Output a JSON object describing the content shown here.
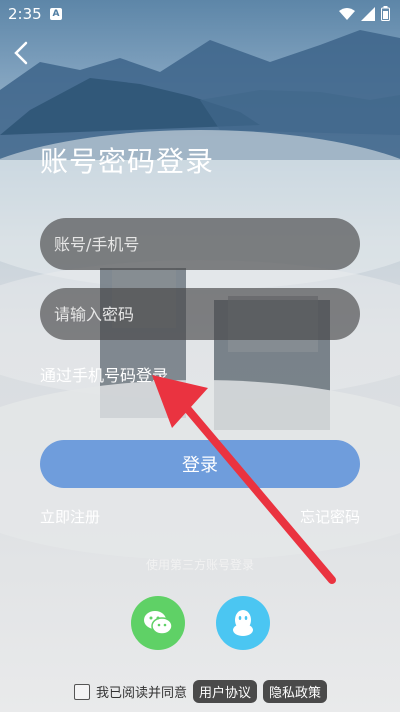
{
  "status": {
    "time": "2:35",
    "app_icon": "A"
  },
  "page": {
    "title": "账号密码登录"
  },
  "form": {
    "account_placeholder": "账号/手机号",
    "password_placeholder": "请输入密码",
    "phone_login_link": "通过手机号码登录",
    "login_button": "登录",
    "register_link": "立即注册",
    "forgot_link": "忘记密码"
  },
  "third_party": {
    "label": "使用第三方账号登录",
    "icons": [
      "wechat-icon",
      "qq-icon"
    ]
  },
  "agreement": {
    "text": "我已阅读并同意",
    "user_agreement": "用户协议",
    "privacy_policy": "隐私政策"
  },
  "colors": {
    "login_button": "#6f9ddc",
    "wechat": "#5fd166",
    "qq": "#4bc6f2",
    "arrow": "#ea3340"
  }
}
